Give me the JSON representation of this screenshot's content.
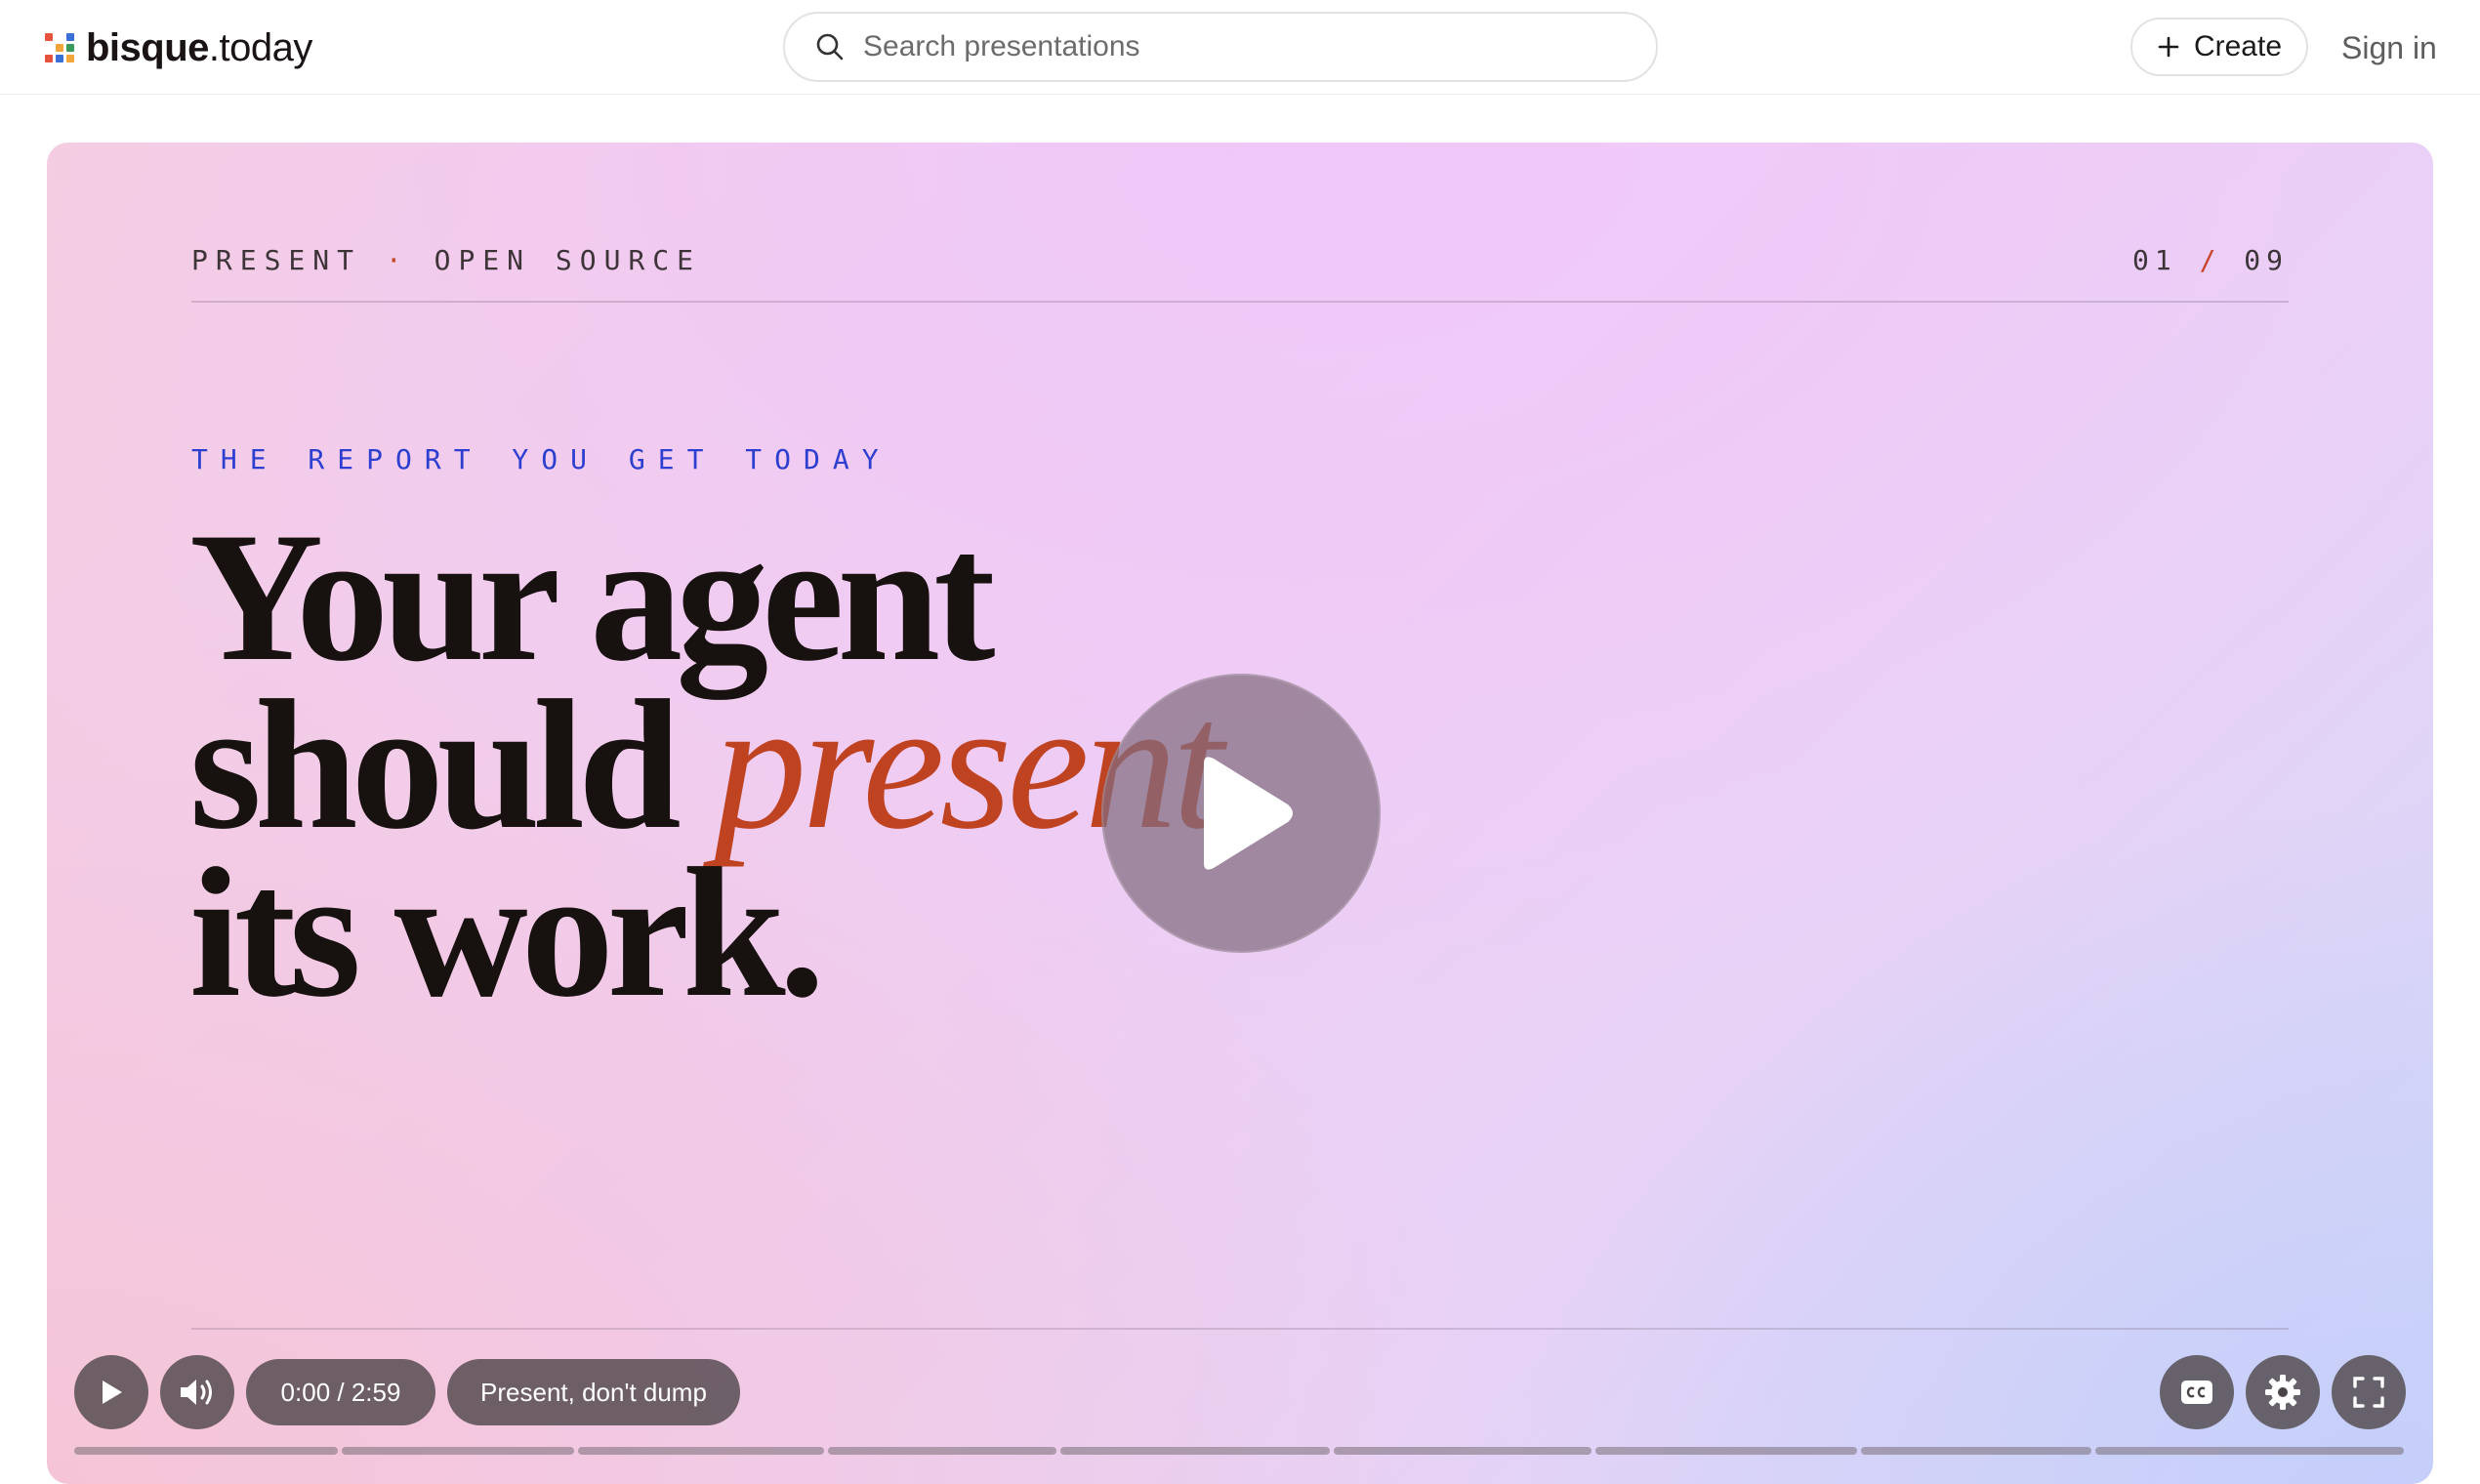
{
  "header": {
    "logo": {
      "bold": "bisque",
      "rest": ".today"
    },
    "logo_colors": [
      "#e5533d",
      "#f2a63a",
      "#3a9b5b",
      "#3a6fd8",
      "#e5533d",
      "#f2a63a",
      "#3a9b5b",
      "#3a6fd8",
      "#e5533d"
    ],
    "search_placeholder": "Search presentations",
    "create_label": "Create",
    "signin_label": "Sign in"
  },
  "slide": {
    "kicker_left": "PRESENT",
    "kicker_sep": "·",
    "kicker_right": "OPEN SOURCE",
    "counter_current": "01",
    "counter_sep": "/",
    "counter_total": "09",
    "eyebrow": "THE REPORT YOU GET TODAY",
    "headline_1": "Your agent",
    "headline_2a": "should",
    "headline_2b": "present",
    "headline_3": "its work.",
    "accent_color": "#bf4221",
    "eyebrow_color": "#2d3fd0"
  },
  "player": {
    "time": "0:00 / 2:59",
    "chapter": "Present, don't dump",
    "progress": 0,
    "chapters": 9
  }
}
